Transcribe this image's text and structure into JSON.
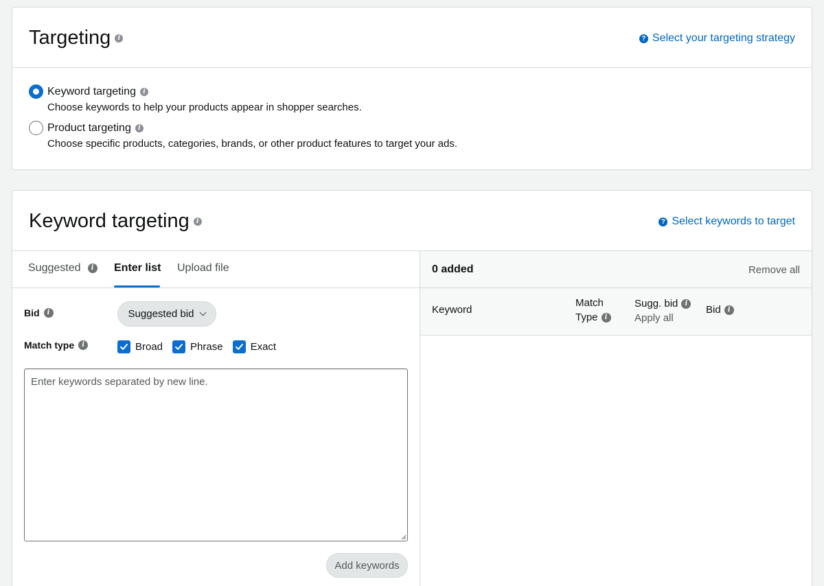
{
  "targeting": {
    "title": "Targeting",
    "help_link": "Select your targeting strategy",
    "options": [
      {
        "label": "Keyword targeting",
        "description": "Choose keywords to help your products appear in shopper searches.",
        "selected": true
      },
      {
        "label": "Product targeting",
        "description": "Choose specific products, categories, brands, or other product features to target your ads.",
        "selected": false
      }
    ]
  },
  "keyword_targeting": {
    "title": "Keyword targeting",
    "help_link": "Select keywords to target",
    "tabs": [
      {
        "label": "Suggested",
        "active": false
      },
      {
        "label": "Enter list",
        "active": true
      },
      {
        "label": "Upload file",
        "active": false
      }
    ],
    "bid_label": "Bid",
    "bid_select_value": "Suggested bid",
    "match_type_label": "Match type",
    "match_types": [
      {
        "label": "Broad",
        "checked": true
      },
      {
        "label": "Phrase",
        "checked": true
      },
      {
        "label": "Exact",
        "checked": true
      }
    ],
    "textarea_placeholder": "Enter keywords separated by new line.",
    "add_button": "Add keywords",
    "added_panel": {
      "count_text": "0 added",
      "remove_all": "Remove all",
      "columns": {
        "keyword": "Keyword",
        "match_line1": "Match",
        "match_line2": "Type",
        "sugg_bid": "Sugg. bid",
        "apply_all": "Apply all",
        "bid": "Bid"
      }
    }
  },
  "colors": {
    "accent": "#0a6ed1",
    "link": "#0066c0",
    "border": "#d5d9d9",
    "page_bg": "#f2f3f3"
  },
  "icons": {
    "info": "info-icon",
    "help": "question-circle-icon",
    "chevron": "chevron-down-icon",
    "check": "checkmark-icon"
  }
}
